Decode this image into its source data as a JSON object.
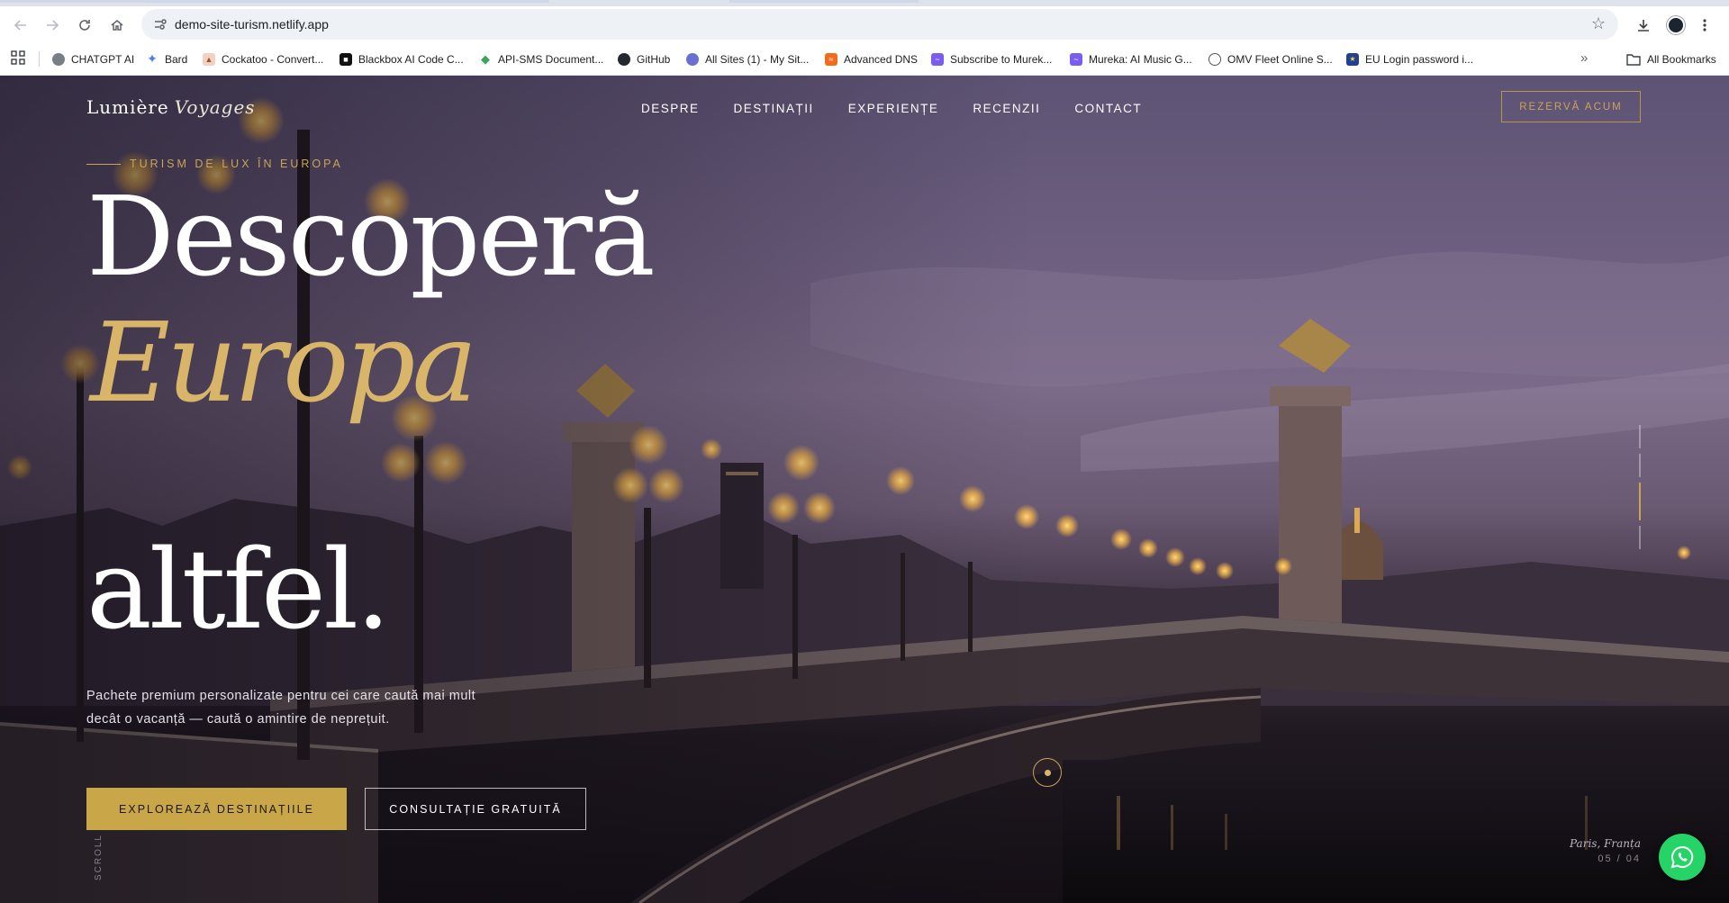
{
  "browser": {
    "url": "demo-site-turism.netlify.app",
    "icons": [
      "back-icon",
      "forward-icon",
      "reload-icon",
      "home-icon",
      "site-info-icon",
      "star-icon",
      "download-icon",
      "profile-icon",
      "menu-icon"
    ]
  },
  "bookmarks": {
    "items": [
      {
        "label": "CHATGPT AI",
        "color": "#7a7f86"
      },
      {
        "label": "Bard",
        "color": "#4d7cf0"
      },
      {
        "label": "Cockatoo - Convert...",
        "color": "#e07a4a"
      },
      {
        "label": "Blackbox AI Code C...",
        "color": "#111111"
      },
      {
        "label": "API-SMS Document...",
        "color": "#3ba55c"
      },
      {
        "label": "GitHub",
        "color": "#24292f"
      },
      {
        "label": "All Sites (1) - My Sit...",
        "color": "#6b6fd1"
      },
      {
        "label": "Advanced DNS",
        "color": "#f26b1d"
      },
      {
        "label": "Subscribe to Murek...",
        "color": "#7b5cf0"
      },
      {
        "label": "Mureka: AI Music G...",
        "color": "#7b5cf0"
      },
      {
        "label": "OMV Fleet Online S...",
        "color": "#555555"
      },
      {
        "label": "EU Login password i...",
        "color": "#1f3f99"
      }
    ],
    "more": "»",
    "all_label": "All Bookmarks"
  },
  "site": {
    "logo_main": "Lumière",
    "logo_italic": "Voyages",
    "nav": [
      "DESPRE",
      "DESTINAȚII",
      "EXPERIENȚE",
      "RECENZII",
      "CONTACT"
    ],
    "cta_top": "REZERVĂ ACUM",
    "eyebrow": "TURISM DE LUX ÎN EUROPA",
    "headline_1": "Descoperă",
    "headline_2": "Europa",
    "headline_3": "altfel.",
    "lead": "Pachete premium personalizate pentru cei care caută mai mult decât o vacanță — caută o amintire de neprețuit.",
    "btn_primary": "EXPLOREAZĂ DESTINAȚIILE",
    "btn_secondary": "CONSULTAȚIE GRATUITĂ",
    "scroll_label": "SCROLL",
    "location": "Paris, Franța",
    "slide_counter": "05 / 04",
    "accent_color": "#c9a456",
    "whatsapp_color": "#25d366"
  }
}
